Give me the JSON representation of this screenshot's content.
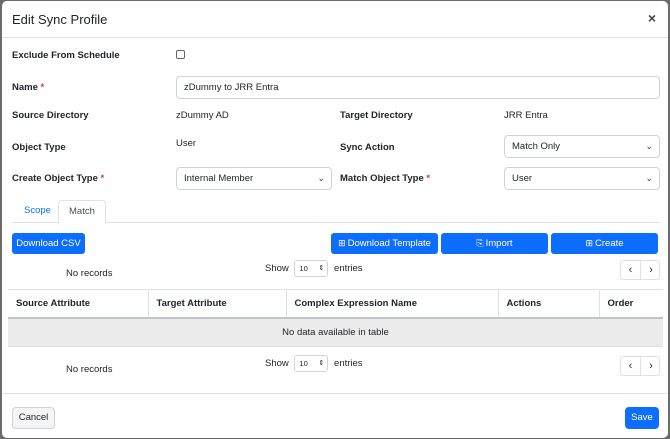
{
  "modal": {
    "title": "Edit Sync Profile",
    "close": "×"
  },
  "form": {
    "exclude_label": "Exclude From Schedule",
    "name_label": "Name",
    "required_mark": "*",
    "name_value": "zDummy to JRR Entra",
    "source_dir_label": "Source Directory",
    "source_dir_value": "zDummy AD",
    "target_dir_label": "Target Directory",
    "target_dir_value": "JRR Entra",
    "object_type_label": "Object Type",
    "object_type_value": "User",
    "sync_action_label": "Sync Action",
    "sync_action_value": "Match Only",
    "create_obj_label": "Create Object Type",
    "create_obj_value": "Internal Member",
    "match_obj_label": "Match Object Type",
    "match_obj_value": "User"
  },
  "tabs": [
    "Scope",
    "Match"
  ],
  "toolbar": {
    "download_csv": "Download CSV",
    "download_template": "Download Template",
    "import": "Import",
    "create": "Create"
  },
  "table_controls": {
    "no_records": "No records",
    "show": "Show",
    "entries_value": "10",
    "entries": "entries"
  },
  "table": {
    "columns": [
      "Source Attribute",
      "Target Attribute",
      "Complex Expression Name",
      "Actions",
      "Order"
    ],
    "empty_text": "No data available in table"
  },
  "footer": {
    "cancel": "Cancel",
    "save": "Save"
  }
}
